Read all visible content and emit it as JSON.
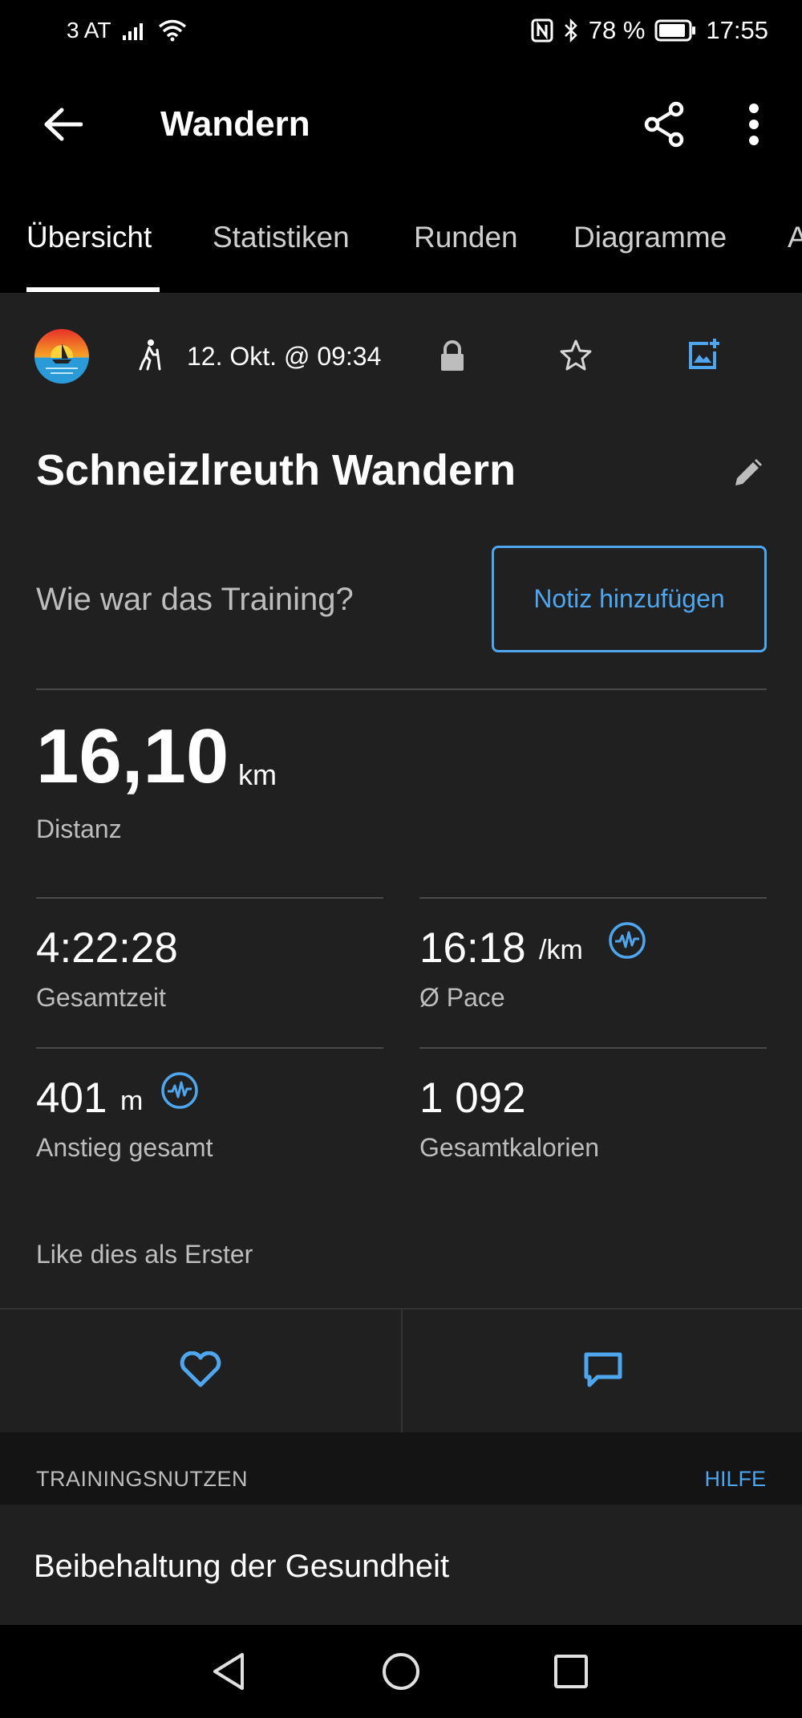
{
  "status_bar": {
    "carrier": "3 AT",
    "battery": "78 %",
    "time": "17:55",
    "icons": [
      "signal-icon",
      "wifi-icon",
      "nfc-icon",
      "bluetooth-icon",
      "battery-icon"
    ]
  },
  "app_bar": {
    "title": "Wandern",
    "icons": [
      "back-arrow-icon",
      "share-icon",
      "more-vert-icon"
    ]
  },
  "tabs": [
    {
      "label": "Übersicht",
      "active": true
    },
    {
      "label": "Statistiken",
      "active": false
    },
    {
      "label": "Runden",
      "active": false
    },
    {
      "label": "Diagramme",
      "active": false
    },
    {
      "label": "A",
      "active": false
    }
  ],
  "activity": {
    "date": "12. Okt. @ 09:34",
    "title": "Schneizlreuth Wandern",
    "question": "Wie war das Training?",
    "note_button": "Notiz hinzufügen",
    "icons": [
      "hiking-icon",
      "lock-icon",
      "star-icon",
      "add-photo-icon",
      "edit-icon"
    ]
  },
  "distance": {
    "value": "16,10",
    "unit": "km",
    "label": "Distanz"
  },
  "stats": [
    {
      "value": "4:22:28",
      "unit": "",
      "label": "Gesamtzeit",
      "has_hr_icon": false
    },
    {
      "value": "16:18",
      "unit": "/km",
      "label": "Ø Pace",
      "has_hr_icon": true
    },
    {
      "value": "401",
      "unit": "m",
      "label": "Anstieg gesamt",
      "has_hr_icon": true
    },
    {
      "value": "1 092",
      "unit": "",
      "label": "Gesamtkalorien",
      "has_hr_icon": false
    }
  ],
  "social": {
    "like_text": "Like dies als Erster",
    "icons": [
      "heart-icon",
      "comment-icon"
    ]
  },
  "training_section": {
    "title": "TRAININGSNUTZEN",
    "help": "HILFE",
    "benefit": "Beibehaltung der Gesundheit"
  },
  "colors": {
    "accent": "#4ea6ee",
    "background": "#000000",
    "card": "#202020",
    "secondary_text": "#bdbdbd"
  }
}
